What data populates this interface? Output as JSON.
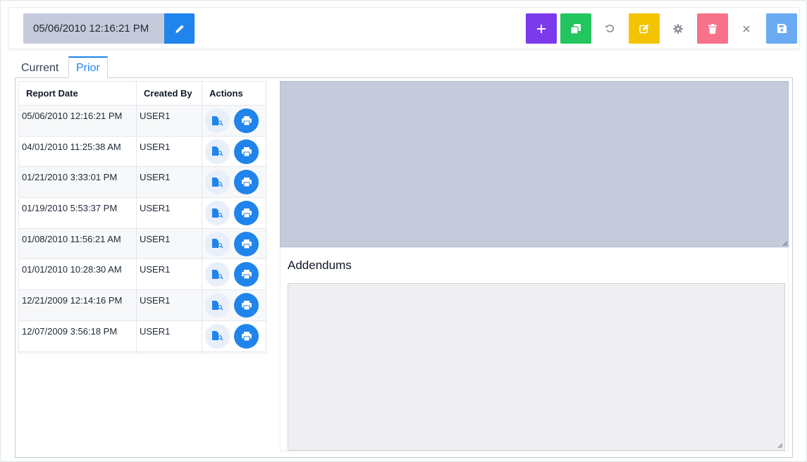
{
  "header": {
    "report_datetime": "05/06/2010 12:16:21 PM"
  },
  "toolbar": {
    "buttons": [
      {
        "name": "add-button",
        "icon": "plus-icon",
        "color": "#7c3aed"
      },
      {
        "name": "copy-button",
        "icon": "copy-icon",
        "color": "#22c55e"
      },
      {
        "name": "undo-button",
        "icon": "undo-icon",
        "color": "#ffffff"
      },
      {
        "name": "edit-button",
        "icon": "edit-icon",
        "color": "#f5c400"
      },
      {
        "name": "settings-button",
        "icon": "gear-icon",
        "color": "#ffffff"
      },
      {
        "name": "delete-button",
        "icon": "trash-icon",
        "color": "#f7728a"
      },
      {
        "name": "close-button",
        "icon": "close-icon",
        "color": "#ffffff"
      },
      {
        "name": "save-button",
        "icon": "save-icon",
        "color": "#6aaaf3"
      }
    ]
  },
  "tabs": [
    {
      "label": "Current",
      "active": false
    },
    {
      "label": "Prior",
      "active": true
    }
  ],
  "table": {
    "columns": [
      "Report Date",
      "Created By",
      "Actions"
    ],
    "rows": [
      {
        "date": "05/06/2010 12:16:21 PM",
        "user": "USER1"
      },
      {
        "date": "04/01/2010 11:25:38 AM",
        "user": "USER1"
      },
      {
        "date": "01/21/2010 3:33:01 PM",
        "user": "USER1"
      },
      {
        "date": "01/19/2010 5:53:37 PM",
        "user": "USER1"
      },
      {
        "date": "01/08/2010 11:56:21 AM",
        "user": "USER1"
      },
      {
        "date": "01/01/2010 10:28:30 AM",
        "user": "USER1"
      },
      {
        "date": "12/21/2009 12:14:16 PM",
        "user": "USER1"
      },
      {
        "date": "12/07/2009 3:56:18 PM",
        "user": "USER1"
      },
      {
        "date": "",
        "user": ""
      }
    ]
  },
  "addendums": {
    "title": "Addendums",
    "text": ""
  },
  "report": {
    "text": ""
  },
  "colors": {
    "accent": "#1f84ec",
    "readonly_bg": "#c6cbdb"
  }
}
